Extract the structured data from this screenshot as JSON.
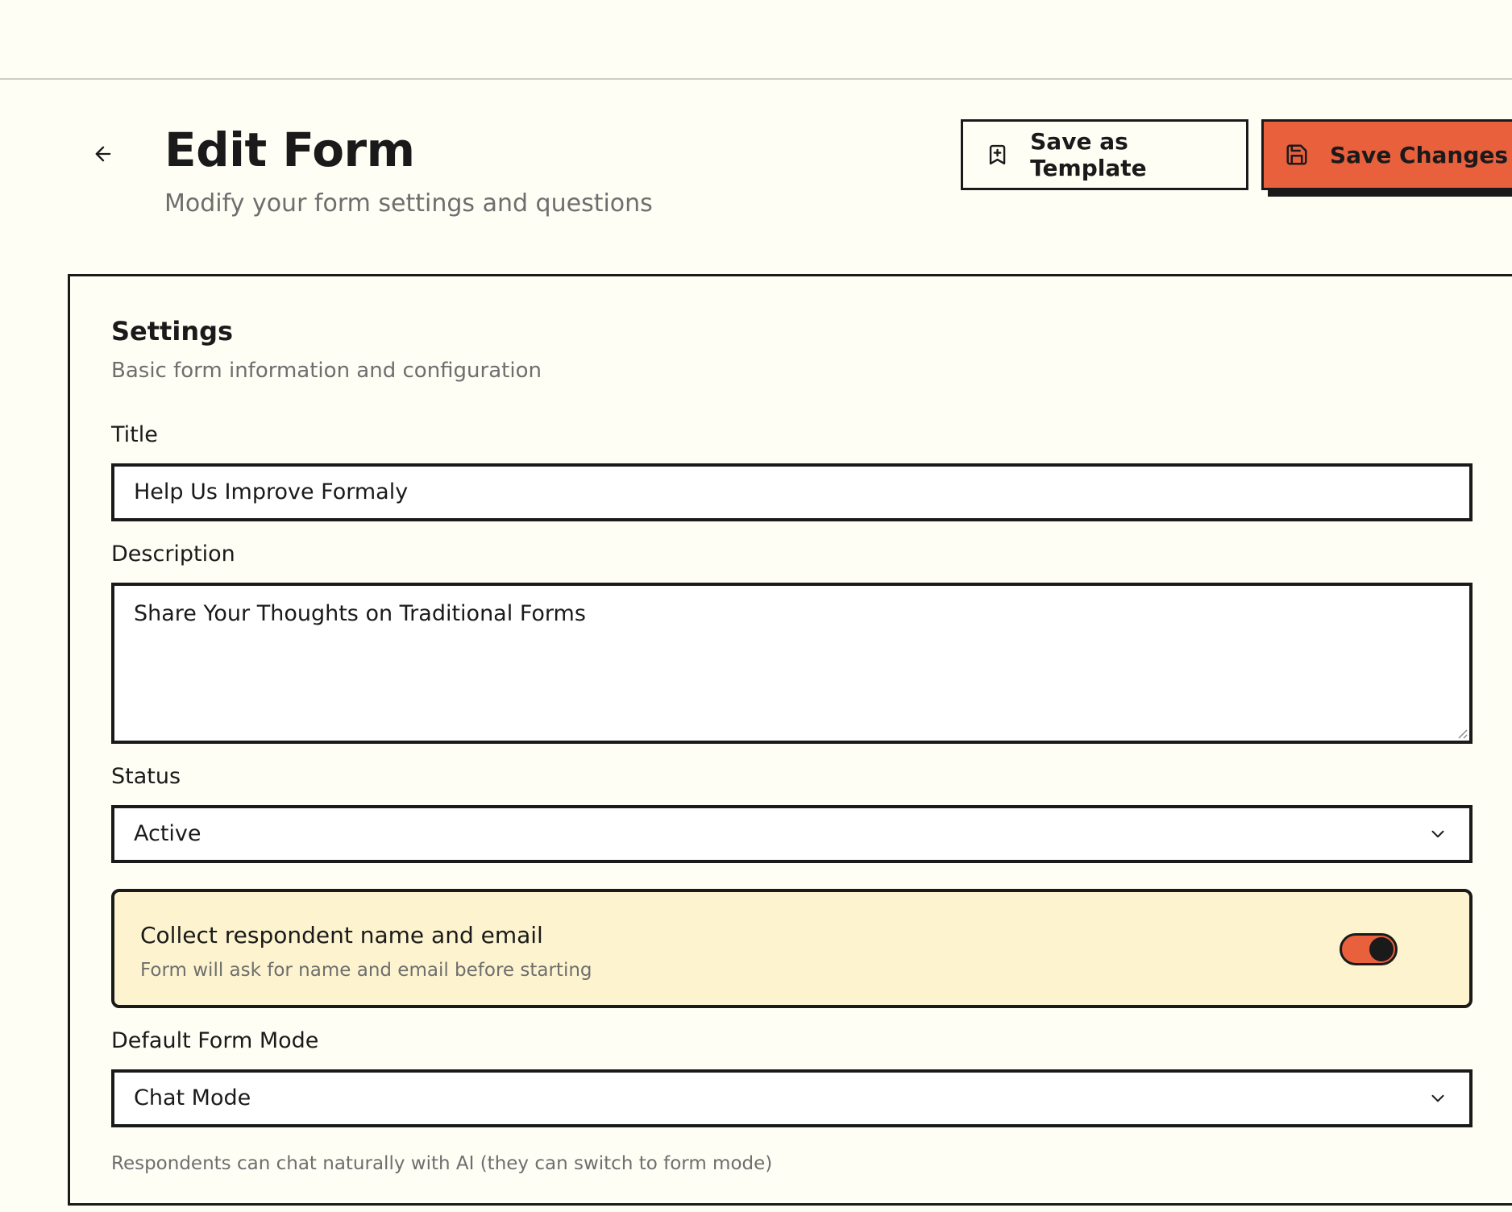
{
  "header": {
    "title": "Edit Form",
    "subtitle": "Modify your form settings and questions",
    "save_template_label": "Save as Template",
    "save_changes_label": "Save Changes"
  },
  "icons": {
    "back": "arrow-left-icon",
    "template": "bookmark-plus-icon",
    "save": "floppy-disk-icon",
    "chevron": "chevron-down-icon"
  },
  "colors": {
    "accent": "#e8603c",
    "background": "#fffef5",
    "highlight": "#fdf4cf",
    "ink": "#1a1a1a"
  },
  "settings": {
    "title": "Settings",
    "description": "Basic form information and configuration",
    "title_label": "Title",
    "title_value": "Help Us Improve Formaly",
    "description_label": "Description",
    "description_value": "Share Your Thoughts on Traditional Forms",
    "status_label": "Status",
    "status_value": "Active",
    "collect": {
      "title": "Collect respondent name and email",
      "description": "Form will ask for name and email before starting",
      "enabled": true
    },
    "mode_label": "Default Form Mode",
    "mode_value": "Chat Mode",
    "mode_help": "Respondents can chat naturally with AI (they can switch to form mode)"
  }
}
